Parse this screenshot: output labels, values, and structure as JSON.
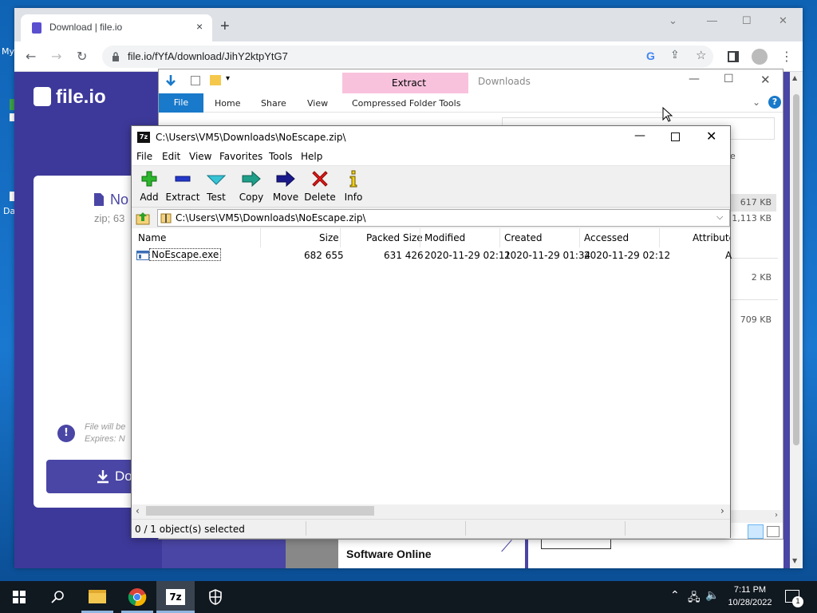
{
  "desktop": {
    "icon1_label": "My",
    "icon2_label": "Da"
  },
  "browser": {
    "tab_title": "Download | file.io",
    "tab_close": "×",
    "new_tab": "+",
    "url": "file.io/fYfA/download/JihY2ktpYtG7",
    "window_controls": {
      "dropdown": "⌄",
      "minimize": "—",
      "maximize": "☐",
      "close": "✕"
    }
  },
  "site": {
    "logo": "file.io",
    "file_name": "No",
    "file_size": "zip; 63",
    "expiry_note_1": "File will be",
    "expiry_note_2": "Expires: N",
    "download_label": "Do",
    "ad_text": "Software Online"
  },
  "explorer": {
    "title": "Downloads",
    "extract_tab": "Extract",
    "ribbon_tabs": [
      "File",
      "Home",
      "Share",
      "View",
      "Compressed Folder Tools"
    ],
    "sizes": [
      "617 KB",
      "1,113 KB",
      "2 KB",
      "709 KB"
    ],
    "partial_letter": "e"
  },
  "sevenzip": {
    "title": "C:\\Users\\VM5\\Downloads\\NoEscape.zip\\",
    "menu": [
      "File",
      "Edit",
      "View",
      "Favorites",
      "Tools",
      "Help"
    ],
    "toolbar": [
      "Add",
      "Extract",
      "Test",
      "Copy",
      "Move",
      "Delete",
      "Info"
    ],
    "address": "C:\\Users\\VM5\\Downloads\\NoEscape.zip\\",
    "columns": [
      "Name",
      "Size",
      "Packed Size",
      "Modified",
      "Created",
      "Accessed",
      "Attributes"
    ],
    "rows": [
      {
        "name": "NoEscape.exe",
        "size": "682 655",
        "packed": "631 426",
        "modified": "2020-11-29 02:11",
        "created": "2020-11-29 01:34",
        "accessed": "2020-11-29 02:12",
        "attributes": "A"
      }
    ],
    "status": "0 / 1 object(s) selected"
  },
  "taskbar": {
    "time": "7:11 PM",
    "date": "10/28/2022",
    "notification_count": "1",
    "active_app": "7z"
  },
  "colors": {
    "brand_purple": "#4a46a5",
    "extract_pink": "#f8c2dd",
    "explorer_blue": "#1979ca",
    "taskbar": "#101820"
  }
}
